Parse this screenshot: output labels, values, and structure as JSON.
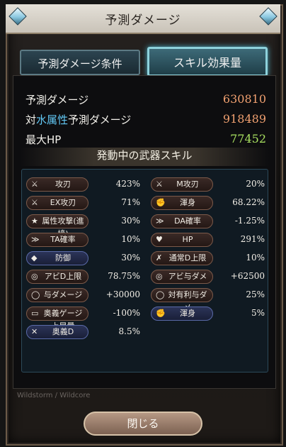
{
  "dialog": {
    "title": "予測ダメージ"
  },
  "tabs": [
    {
      "label": "予測ダメージ条件"
    },
    {
      "label": "スキル効果量"
    }
  ],
  "stats": {
    "predicted_damage": {
      "label": "予測ダメージ",
      "value": "630810",
      "color": "#f0a070"
    },
    "vs_element": {
      "prefix": "対",
      "element": "水属性",
      "suffix": "予測ダメージ",
      "value": "918489",
      "color": "#f0a070"
    },
    "max_hp": {
      "label": "最大HP",
      "value": "77452",
      "color": "#a8e060"
    }
  },
  "section_title": "発動中の武器スキル",
  "skills_left": [
    {
      "label": "攻刃",
      "value": "423%",
      "icon": "sword-icon",
      "glyph": "⚔",
      "style": "red"
    },
    {
      "label": "EX攻刃",
      "value": "71%",
      "icon": "sword-icon",
      "glyph": "⚔",
      "style": "red"
    },
    {
      "label": "属性攻撃(進境)",
      "value": "30%",
      "icon": "star-icon",
      "glyph": "★",
      "style": "red"
    },
    {
      "label": "TA確率",
      "value": "10%",
      "icon": "slash-icon",
      "glyph": "≫",
      "style": "red"
    },
    {
      "label": "防御",
      "value": "30%",
      "icon": "shield-icon",
      "glyph": "◆",
      "style": "blue"
    },
    {
      "label": "アビD上限",
      "value": "78.75%",
      "icon": "ability-icon",
      "glyph": "◎",
      "style": "red"
    },
    {
      "label": "与ダメージ",
      "value": "+30000",
      "icon": "ring-icon",
      "glyph": "◯",
      "style": "red"
    },
    {
      "label": "奥義ゲージ上昇量",
      "value": "-100%",
      "icon": "gauge-icon",
      "glyph": "▭",
      "style": "red"
    },
    {
      "label": "奥義D",
      "value": "8.5%",
      "icon": "cross-swords-icon",
      "glyph": "✕",
      "style": "blue"
    }
  ],
  "skills_right": [
    {
      "label": "M攻刃",
      "value": "20%",
      "icon": "sword-icon",
      "glyph": "⚔",
      "style": "red"
    },
    {
      "label": "渾身",
      "value": "68.22%",
      "icon": "arm-icon",
      "glyph": "✊",
      "style": "red"
    },
    {
      "label": "DA確率",
      "value": "-1.25%",
      "icon": "slash-icon",
      "glyph": "≫",
      "style": "red"
    },
    {
      "label": "HP",
      "value": "291%",
      "icon": "heart-icon",
      "glyph": "♥",
      "style": "red"
    },
    {
      "label": "通常D上限",
      "value": "10%",
      "icon": "normal-attack-icon",
      "glyph": "✗",
      "style": "red"
    },
    {
      "label": "アビ与ダメ",
      "value": "+62500",
      "icon": "ability-icon",
      "glyph": "◎",
      "style": "red"
    },
    {
      "label": "対有利与ダメ",
      "value": "25%",
      "icon": "ring-icon",
      "glyph": "◯",
      "style": "red"
    },
    {
      "label": "渾身",
      "value": "5%",
      "icon": "arm-icon",
      "glyph": "✊",
      "style": "blue"
    }
  ],
  "close_button": {
    "label": "閉じる"
  },
  "background_text": "Wildstorm / Wildcore"
}
